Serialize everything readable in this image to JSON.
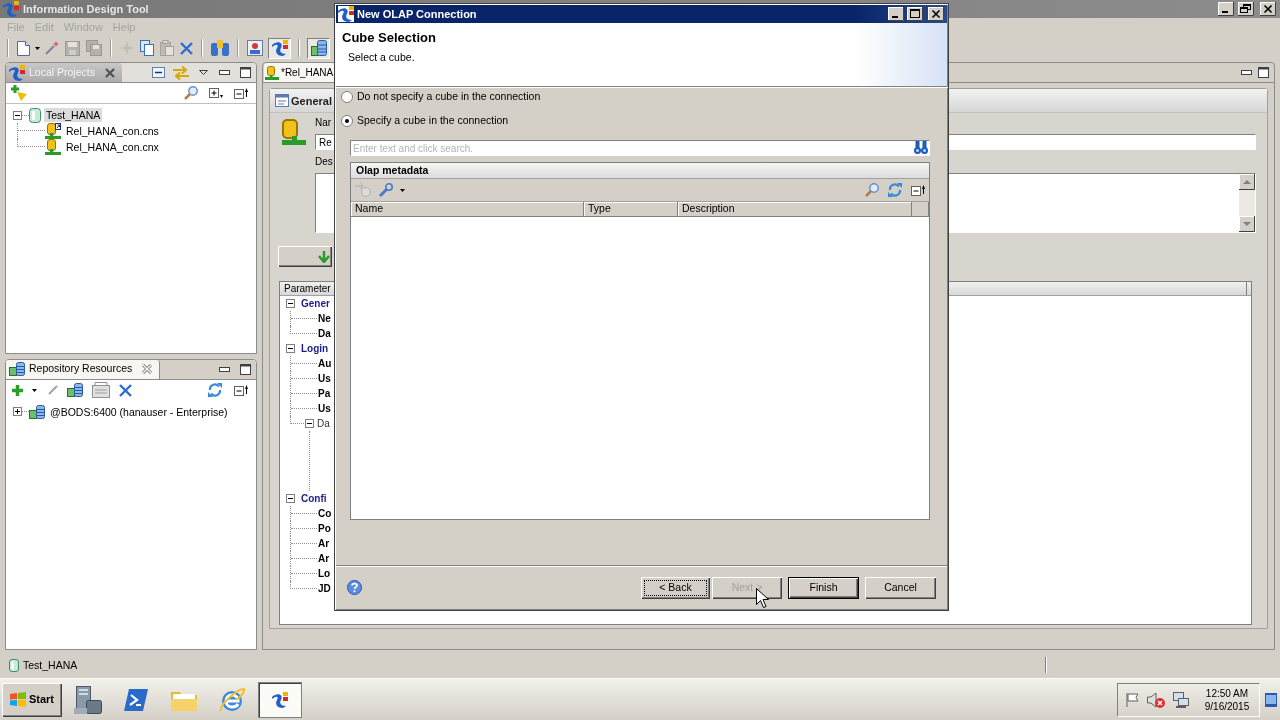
{
  "app_window": {
    "title": "Information Design Tool"
  },
  "menu": [
    {
      "label": "File",
      "disabled": true
    },
    {
      "label": "Edit",
      "disabled": true
    },
    {
      "label": "Window",
      "disabled": true
    },
    {
      "label": "Help",
      "disabled": true
    }
  ],
  "toolbar": [
    [
      {
        "kind": "new",
        "disabled": false,
        "pressed": false
      },
      {
        "kind": "wizard",
        "disabled": false,
        "pressed": false
      },
      {
        "kind": "save",
        "disabled": true,
        "pressed": false
      },
      {
        "kind": "save_all",
        "disabled": true,
        "pressed": false
      }
    ],
    [
      {
        "kind": "sparkle",
        "disabled": true,
        "pressed": false
      },
      {
        "kind": "copy",
        "disabled": false,
        "pressed": false
      },
      {
        "kind": "paste",
        "disabled": true,
        "pressed": false
      },
      {
        "kind": "delete",
        "disabled": false,
        "pressed": false
      }
    ],
    [
      {
        "kind": "connect",
        "disabled": false,
        "pressed": false
      }
    ],
    [
      {
        "kind": "card",
        "disabled": false,
        "pressed": false
      },
      {
        "kind": "logo",
        "disabled": false,
        "pressed": true
      }
    ],
    [
      {
        "kind": "database",
        "disabled": false,
        "pressed": true
      }
    ]
  ],
  "local_projects": {
    "title": "Local Projects",
    "tree": [
      {
        "label": "Test_HANA",
        "kind": "project",
        "expanded": true,
        "selected": true,
        "children": [
          {
            "label": "Rel_HANA_con.cns",
            "kind": "shortcut",
            "selected": false
          },
          {
            "label": "Rel_HANA_con.cnx",
            "kind": "connection",
            "selected": false
          }
        ]
      }
    ]
  },
  "repository_resources": {
    "title": "Repository Resources",
    "tree": [
      {
        "label": "@BODS:6400 (hanauser - Enterprise)",
        "kind": "session",
        "expanded": false,
        "selected": false
      }
    ]
  },
  "editor": {
    "tab": "*Rel_HANA",
    "section": "General",
    "name_label": "Nar",
    "name_value": "Re",
    "description_label": "Des",
    "table_header": "Parameter",
    "parameters": [
      {
        "label": "Gener",
        "kind": "group",
        "expanded": true,
        "children": [
          {
            "label": "Ne",
            "kind": "parameter"
          },
          {
            "label": "Da",
            "kind": "parameter"
          }
        ]
      },
      {
        "label": "Login",
        "kind": "group",
        "expanded": true,
        "children": [
          {
            "label": "Au",
            "kind": "parameter"
          },
          {
            "label": "Us",
            "kind": "parameter"
          },
          {
            "label": "Pa",
            "kind": "parameter"
          },
          {
            "label": "Us",
            "kind": "parameter"
          },
          {
            "label": "Da",
            "kind": "subgroup",
            "expanded": true
          }
        ]
      },
      {
        "label": "Confi",
        "kind": "group",
        "expanded": true,
        "children": [
          {
            "label": "Co",
            "kind": "parameter"
          },
          {
            "label": "Po",
            "kind": "parameter"
          },
          {
            "label": "Ar",
            "kind": "parameter"
          },
          {
            "label": "Ar",
            "kind": "parameter"
          },
          {
            "label": "Lo",
            "kind": "parameter"
          },
          {
            "label": "JD",
            "kind": "parameter"
          }
        ]
      }
    ]
  },
  "status_bar": {
    "text": "Test_HANA"
  },
  "taskbar": {
    "start": "Start",
    "apps": [
      {
        "kind": "server_manager",
        "active": false
      },
      {
        "kind": "powershell",
        "active": false
      },
      {
        "kind": "explorer",
        "active": false
      },
      {
        "kind": "browser",
        "active": false
      },
      {
        "kind": "idt",
        "active": true
      }
    ],
    "time": "12:50 AM",
    "date": "9/16/2015"
  },
  "dialog": {
    "title": "New OLAP Connection",
    "heading": "Cube Selection",
    "description": "Select a cube.",
    "options": [
      {
        "label": "Do not specify a cube in the connection",
        "selected": false
      },
      {
        "label": "Specify a cube in the connection",
        "selected": true
      }
    ],
    "search": {
      "placeholder": "Enter text and click search."
    },
    "metadata": {
      "title": "Olap metadata",
      "columns": [
        "Name",
        "Type",
        "Description"
      ]
    },
    "buttons": [
      {
        "label": "< Back",
        "disabled": false,
        "default": false,
        "focused": true
      },
      {
        "label": "Next >",
        "disabled": true,
        "default": false,
        "focused": false
      },
      {
        "label": "Finish",
        "disabled": false,
        "default": true,
        "focused": false
      },
      {
        "label": "Cancel",
        "disabled": false,
        "default": false,
        "focused": false
      }
    ]
  }
}
